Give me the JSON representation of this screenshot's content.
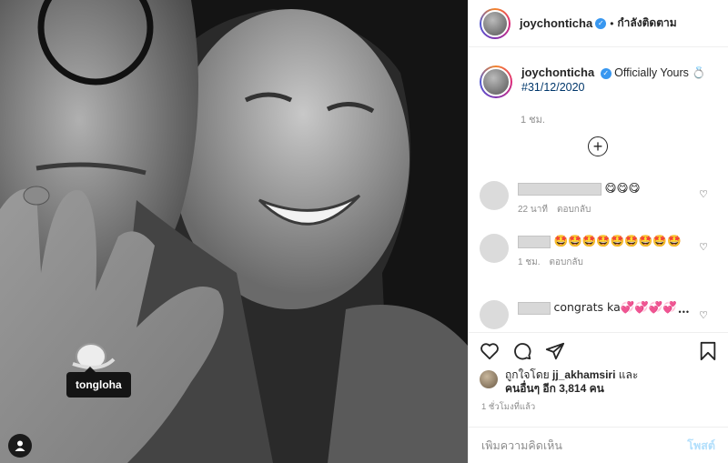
{
  "header": {
    "username": "joychonticha",
    "separator": "•",
    "follow_label": "กำลังติดตาม"
  },
  "photo": {
    "tag_label": "tongloha",
    "tag_icon": "user-icon"
  },
  "caption": {
    "username": "joychonticha",
    "text": "Officially Yours 💍",
    "hashtag": "#31/12/2020",
    "time": "1 ชม."
  },
  "load_more_icon": "plus-circle-icon",
  "comments": [
    {
      "text": "😋😋😋",
      "time": "22 นาที",
      "reply": "ตอบกลับ"
    },
    {
      "text": "🤩🤩🤩🤩🤩🤩🤩🤩🤩",
      "time": "1 ชม.",
      "reply": "ตอบกลับ"
    },
    {
      "text": "congrats ka💞💞💞💞",
      "more": "•••"
    }
  ],
  "actions": {
    "like_icon": "heart-icon",
    "comment_icon": "comment-icon",
    "share_icon": "share-icon",
    "save_icon": "bookmark-icon"
  },
  "likes": {
    "prefix": "ถูกใจโดย",
    "user": "jj_akhamsiri",
    "and": "และ",
    "others": "คนอื่นๆ อีก 3,814 คน"
  },
  "time_ago": "1 ชั่วโมงที่แล้ว",
  "add_comment": {
    "placeholder": "เพิ่มความคิดเห็น",
    "post_label": "โพสต์"
  },
  "colors": {
    "verified": "#3897f0",
    "hashtag": "#00376b",
    "post_disabled": "#b2dffc"
  }
}
